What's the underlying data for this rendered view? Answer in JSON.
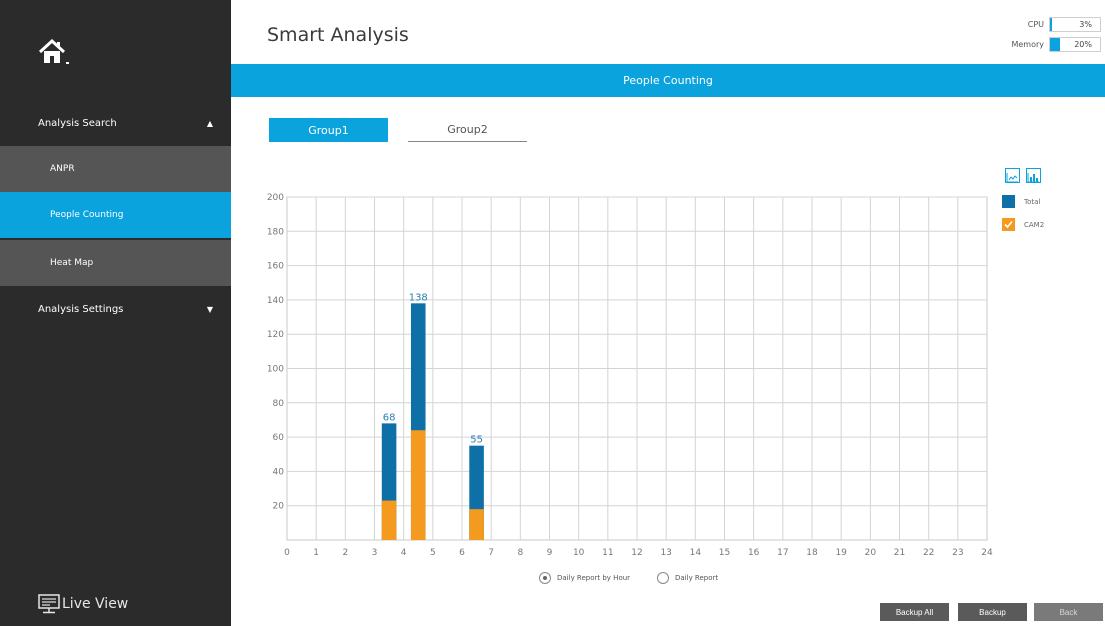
{
  "sidebar": {
    "analysis_search": "Analysis Search",
    "items": [
      {
        "label": "ANPR"
      },
      {
        "label": "People Counting"
      },
      {
        "label": "Heat Map"
      }
    ],
    "analysis_settings": "Analysis Settings",
    "live_view": "Live View"
  },
  "header": {
    "title": "Smart Analysis",
    "cpu_label": "CPU",
    "cpu_value": "3%",
    "cpu_percent": 3,
    "memory_label": "Memory",
    "memory_value": "20%",
    "memory_percent": 20
  },
  "banner": {
    "title": "People Counting"
  },
  "tabs": [
    {
      "label": "Group1",
      "active": true
    },
    {
      "label": "Group2",
      "active": false
    }
  ],
  "legend": [
    {
      "label": "Total",
      "color": "#0f70a8"
    },
    {
      "label": "CAM2",
      "color": "#f39a1f"
    }
  ],
  "report_options": [
    {
      "label": "Daily Report by Hour",
      "selected": true
    },
    {
      "label": "Daily Report",
      "selected": false
    }
  ],
  "buttons": {
    "backup_all": "Backup All",
    "backup": "Backup",
    "back": "Back"
  },
  "colors": {
    "accent": "#0aa3de",
    "sidebar_bg": "#2b2b2b",
    "total": "#0f70a8",
    "cam2": "#f39a1f"
  },
  "chart_data": {
    "type": "bar",
    "x_ticks": [
      "0",
      "1",
      "2",
      "3",
      "4",
      "5",
      "6",
      "7",
      "8",
      "9",
      "10",
      "11",
      "12",
      "13",
      "14",
      "15",
      "16",
      "17",
      "18",
      "19",
      "20",
      "21",
      "22",
      "23",
      "24"
    ],
    "y_ticks": [
      "20",
      "40",
      "60",
      "80",
      "100",
      "120",
      "140",
      "160",
      "180",
      "200"
    ],
    "ylim": [
      0,
      200
    ],
    "xlim": [
      0,
      24
    ],
    "grid": true,
    "legend_position": "right",
    "bars": [
      {
        "hour": 3,
        "total": 68,
        "cam2": 23,
        "label": "68"
      },
      {
        "hour": 4,
        "total": 138,
        "cam2": 64,
        "label": "138"
      },
      {
        "hour": 6,
        "total": 55,
        "cam2": 18,
        "label": "55"
      }
    ],
    "series": [
      {
        "name": "Total",
        "values_by_hour": {
          "3": 68,
          "4": 138,
          "6": 55
        }
      },
      {
        "name": "CAM2",
        "values_by_hour": {
          "3": 23,
          "4": 64,
          "6": 18
        }
      }
    ]
  }
}
